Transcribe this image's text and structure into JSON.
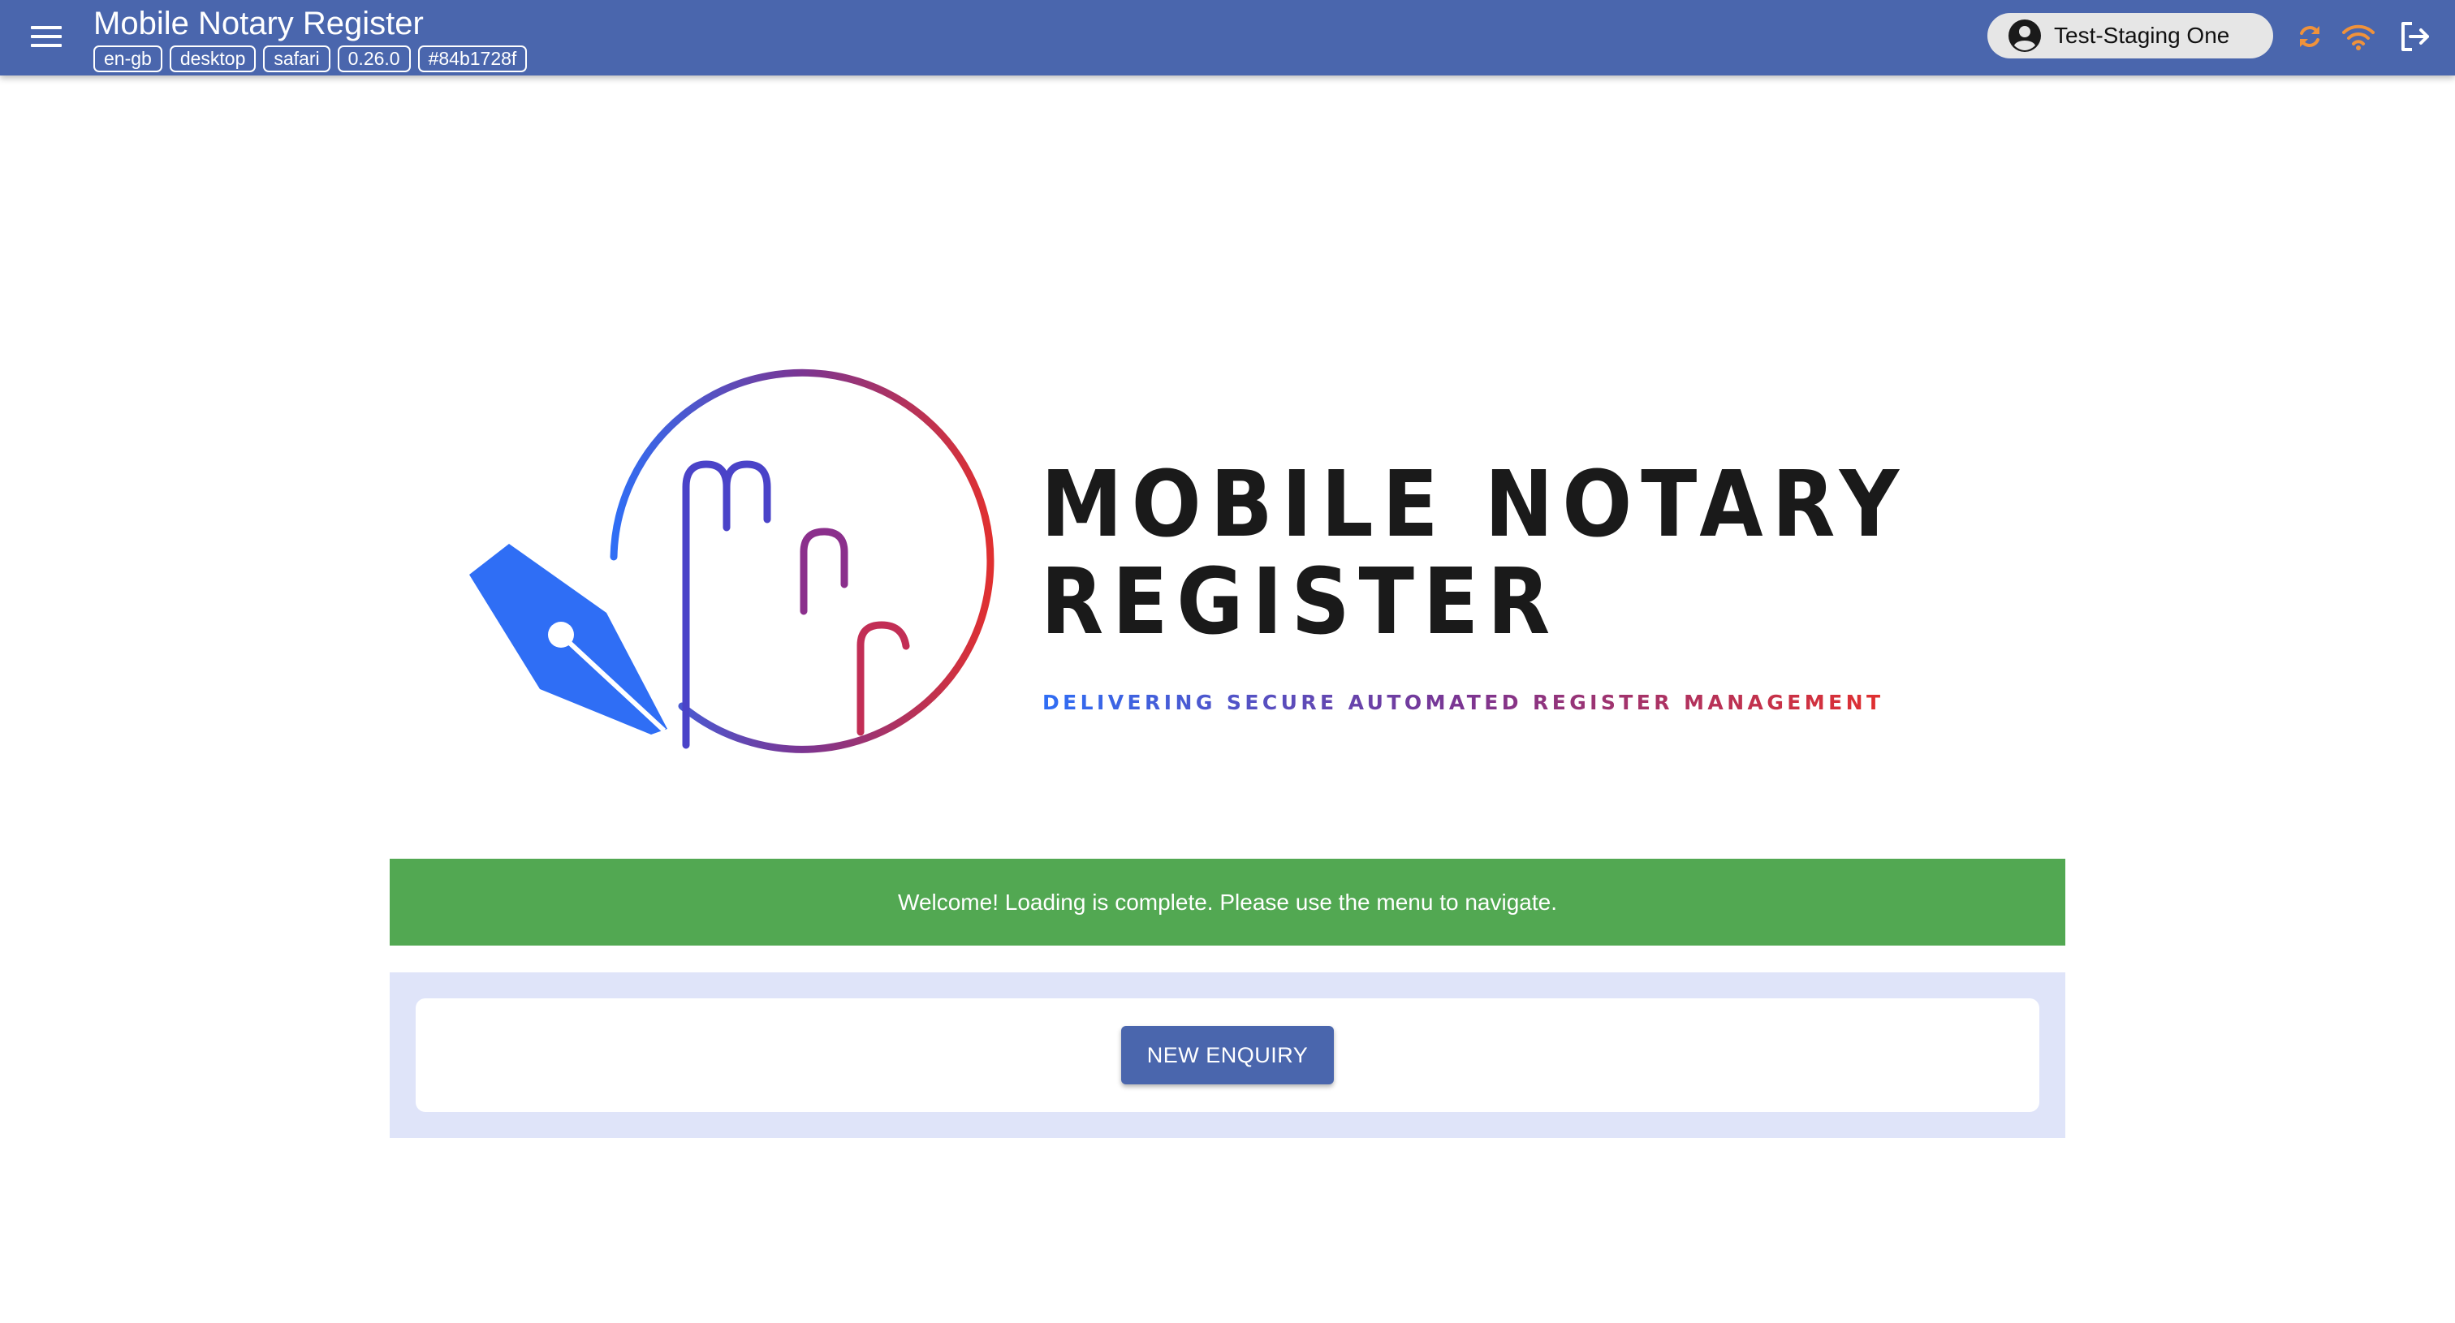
{
  "app": {
    "title": "Mobile Notary Register",
    "chips": [
      "en-gb",
      "desktop",
      "safari",
      "0.26.0",
      "#84b1728f"
    ]
  },
  "toolbar": {
    "user_name": "Test-Staging One",
    "icons": {
      "menu": "menu-icon",
      "user": "account-circle-icon",
      "sync": "sync-icon",
      "connection": "wifi-icon",
      "logout": "logout-icon"
    },
    "colors": {
      "appbar": "#4a66ad",
      "status_orange": "#f0923a"
    }
  },
  "logo": {
    "line1": "MOBILE NOTARY",
    "line2": "REGISTER",
    "tagline": "DELIVERING SECURE AUTOMATED REGISTER MANAGEMENT",
    "colors": {
      "blue": "#2f6ef5",
      "purple": "#7b3592",
      "red": "#e03030",
      "text": "#1a1a1a"
    }
  },
  "welcome": {
    "message": "Welcome! Loading is complete. Please use the menu to navigate.",
    "color": "#52a852"
  },
  "actions": {
    "new_enquiry_label": "NEW ENQUIRY"
  }
}
